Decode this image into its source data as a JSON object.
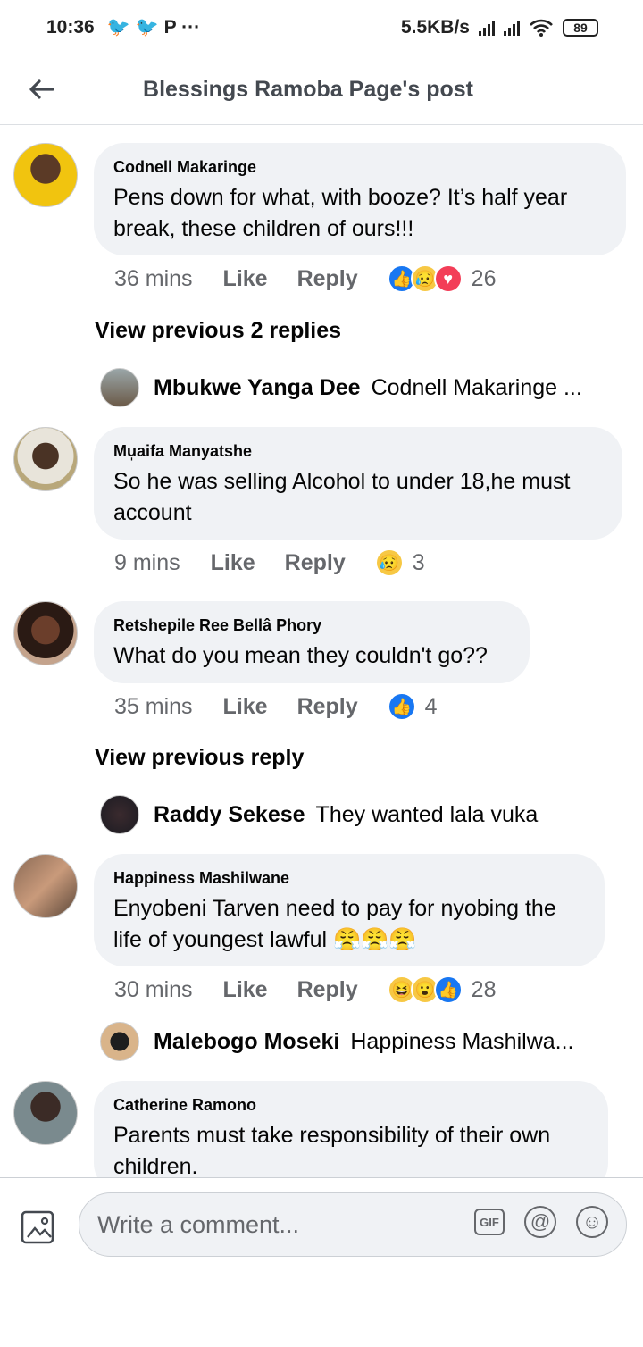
{
  "status": {
    "time": "10:36",
    "left_icons": "🐦 🐦 P ···",
    "network": "5.5KB/s",
    "battery": "89"
  },
  "header": {
    "title": "Blessings Ramoba Page's post"
  },
  "comments": [
    {
      "name": "Codnell Makaringe",
      "text": "Pens down for what, with booze?  It’s half year break, these children of ours!!!",
      "time": "36 mins",
      "like": "Like",
      "reply": "Reply",
      "count": "26"
    },
    {
      "name": "Mu̩aifa Manyatshe",
      "text": "So he was selling Alcohol to under 18,he must account",
      "time": "9 mins",
      "like": "Like",
      "reply": "Reply",
      "count": "3"
    },
    {
      "name": "Retshepile Ree Bellâ Phory",
      "text": "What do you mean they couldn't go??",
      "time": "35 mins",
      "like": "Like",
      "reply": "Reply",
      "count": "4"
    },
    {
      "name": "Happiness Mashilwane",
      "text": "Enyobeni Tarven need to pay for nyobing the life of youngest lawful 😤😤😤",
      "time": "30 mins",
      "like": "Like",
      "reply": "Reply",
      "count": "28"
    },
    {
      "name": "Catherine Ramono",
      "text": "Parents must take responsibility of their own children."
    }
  ],
  "view_prev": [
    "View previous 2 replies",
    "View previous reply"
  ],
  "replies": [
    {
      "name": "Mbukwe Yanga Dee",
      "text": "Codnell Makaringe ..."
    },
    {
      "name": "Raddy Sekese",
      "text": "They wanted lala vuka"
    },
    {
      "name": "Malebogo Moseki",
      "text": "Happiness Mashilwa..."
    }
  ],
  "composer": {
    "placeholder": "Write a comment...",
    "gif": "GIF",
    "at": "@",
    "emoji": "☺"
  }
}
